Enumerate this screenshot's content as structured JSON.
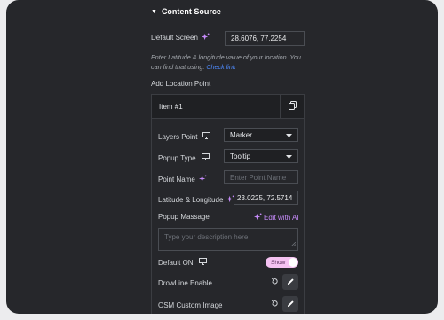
{
  "section": {
    "title": "Content Source"
  },
  "default_screen": {
    "label": "Default Screen",
    "value": "28.6076, 77.2254"
  },
  "description": {
    "text": "Enter Latitude & longitude value of your location. You can find that using.",
    "link": "Check link"
  },
  "location_points": {
    "title": "Add Location Point",
    "item_title": "Item #1",
    "layers_point": {
      "label": "Layers Point",
      "value": "Marker"
    },
    "popup_type": {
      "label": "Popup Type",
      "value": "Tooltip"
    },
    "point_name": {
      "label": "Point Name",
      "placeholder": "Enter Point Name"
    },
    "lat_long": {
      "label": "Latitude & Longitude",
      "value": "23.0225, 72.5714"
    },
    "popup_message": {
      "label": "Popup Massage",
      "edit_ai": "Edit with AI",
      "placeholder": "Type your description here"
    },
    "default_on": {
      "label": "Default ON",
      "toggle_text": "Show"
    },
    "drowline": {
      "label": "DrowLine Enable"
    },
    "osm_image": {
      "label": "OSM Custom Image"
    }
  },
  "colors": {
    "panel": "#26272b",
    "accent_ai": "#c58af9",
    "link": "#4f8cff",
    "toggle": "#f5c2f2"
  }
}
